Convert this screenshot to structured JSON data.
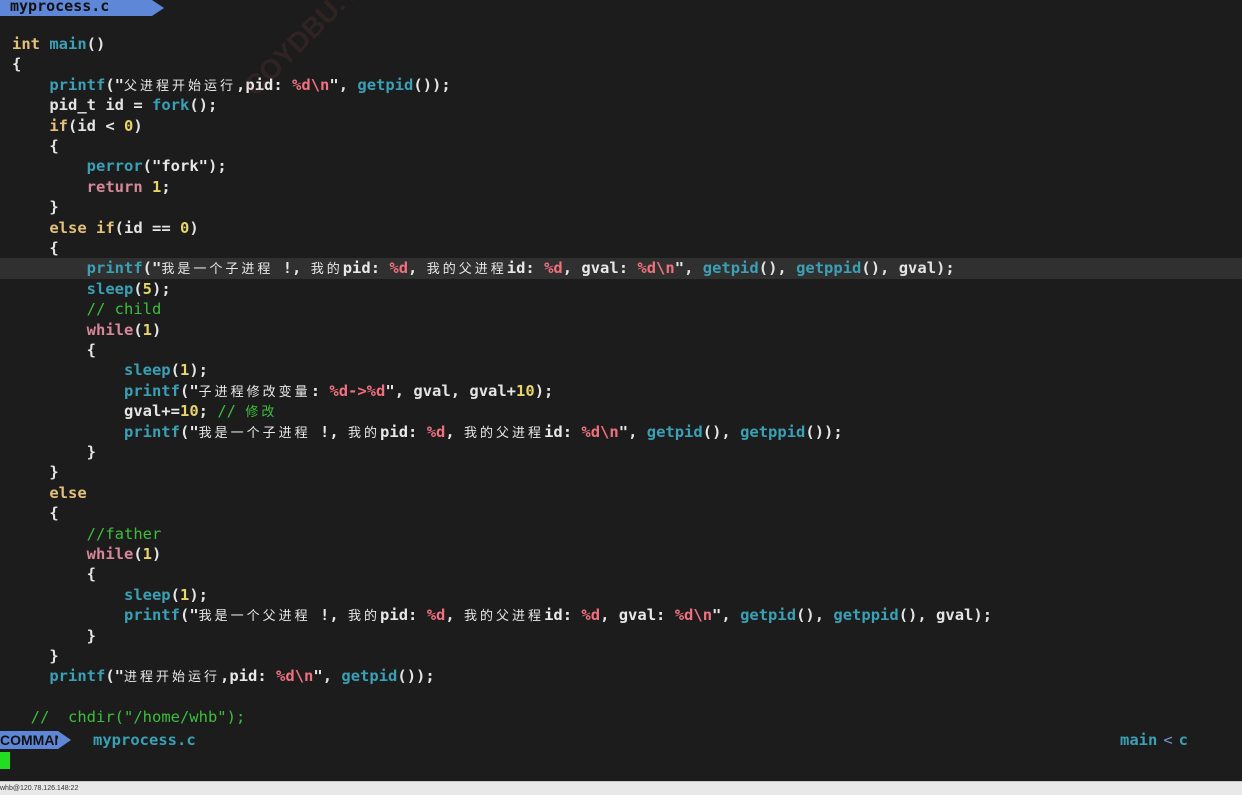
{
  "tabline": {
    "active_tab": "myprocess.c"
  },
  "watermark": "COYDBU.YOU",
  "code_lines": [
    {
      "tokens": [
        [
          "kw",
          "int"
        ],
        [
          "pun",
          " "
        ],
        [
          "fn",
          "main"
        ],
        [
          "pun",
          "()"
        ]
      ]
    },
    {
      "tokens": [
        [
          "pun",
          "{"
        ]
      ]
    },
    {
      "tokens": [
        [
          "pun",
          "    "
        ],
        [
          "fn",
          "printf"
        ],
        [
          "pun",
          "("
        ],
        [
          "str",
          "\""
        ],
        [
          "cjk",
          "父进程开始运行"
        ],
        [
          "str",
          ",pid: "
        ],
        [
          "fmt",
          "%d\\n"
        ],
        [
          "str",
          "\""
        ],
        [
          "pun",
          ", "
        ],
        [
          "fn",
          "getpid"
        ],
        [
          "pun",
          "());"
        ]
      ]
    },
    {
      "tokens": [
        [
          "pun",
          "    "
        ],
        [
          "pun",
          "pid_t id = "
        ],
        [
          "fn",
          "fork"
        ],
        [
          "pun",
          "();"
        ]
      ]
    },
    {
      "tokens": [
        [
          "pun",
          "    "
        ],
        [
          "kw",
          "if"
        ],
        [
          "pun",
          "(id < "
        ],
        [
          "num",
          "0"
        ],
        [
          "pun",
          ")"
        ]
      ]
    },
    {
      "tokens": [
        [
          "pun",
          "    {"
        ]
      ]
    },
    {
      "tokens": [
        [
          "pun",
          "        "
        ],
        [
          "fn",
          "perror"
        ],
        [
          "pun",
          "("
        ],
        [
          "str",
          "\"fork\""
        ],
        [
          "pun",
          ");"
        ]
      ]
    },
    {
      "tokens": [
        [
          "pun",
          "        "
        ],
        [
          "ty",
          "return"
        ],
        [
          "pun",
          " "
        ],
        [
          "num",
          "1"
        ],
        [
          "pun",
          ";"
        ]
      ]
    },
    {
      "tokens": [
        [
          "pun",
          "    }"
        ]
      ]
    },
    {
      "tokens": [
        [
          "pun",
          "    "
        ],
        [
          "kw",
          "else if"
        ],
        [
          "pun",
          "(id == "
        ],
        [
          "num",
          "0"
        ],
        [
          "pun",
          ")"
        ]
      ]
    },
    {
      "tokens": [
        [
          "pun",
          "    {"
        ]
      ]
    },
    {
      "cursorline": true,
      "tokens": [
        [
          "pun",
          "        "
        ],
        [
          "fn",
          "printf"
        ],
        [
          "pun",
          "("
        ],
        [
          "str",
          "\""
        ],
        [
          "cjk",
          "我是一个子进程"
        ],
        [
          "str",
          " !, "
        ],
        [
          "cjk",
          "我的"
        ],
        [
          "str",
          "pid: "
        ],
        [
          "fmt",
          "%d"
        ],
        [
          "str",
          ", "
        ],
        [
          "cjk",
          "我的父进程"
        ],
        [
          "str",
          "id: "
        ],
        [
          "fmt",
          "%d"
        ],
        [
          "str",
          ", gval: "
        ],
        [
          "fmt",
          "%d\\n"
        ],
        [
          "str",
          "\""
        ],
        [
          "pun",
          ", "
        ],
        [
          "fn",
          "getpid"
        ],
        [
          "pun",
          "(), "
        ],
        [
          "fn",
          "getppid"
        ],
        [
          "pun",
          "(), gval);"
        ]
      ]
    },
    {
      "tokens": [
        [
          "pun",
          "        "
        ],
        [
          "fn",
          "sleep"
        ],
        [
          "pun",
          "("
        ],
        [
          "num",
          "5"
        ],
        [
          "pun",
          ");"
        ]
      ]
    },
    {
      "tokens": [
        [
          "pun",
          "        "
        ],
        [
          "cm",
          "// child"
        ]
      ]
    },
    {
      "tokens": [
        [
          "pun",
          "        "
        ],
        [
          "ty",
          "while"
        ],
        [
          "pun",
          "("
        ],
        [
          "num",
          "1"
        ],
        [
          "pun",
          ")"
        ]
      ]
    },
    {
      "tokens": [
        [
          "pun",
          "        {"
        ]
      ]
    },
    {
      "tokens": [
        [
          "pun",
          "            "
        ],
        [
          "fn",
          "sleep"
        ],
        [
          "pun",
          "("
        ],
        [
          "num",
          "1"
        ],
        [
          "pun",
          ");"
        ]
      ]
    },
    {
      "tokens": [
        [
          "pun",
          "            "
        ],
        [
          "fn",
          "printf"
        ],
        [
          "pun",
          "("
        ],
        [
          "str",
          "\""
        ],
        [
          "cjk",
          "子进程修改变量"
        ],
        [
          "str",
          ": "
        ],
        [
          "fmt",
          "%d->%d"
        ],
        [
          "str",
          "\""
        ],
        [
          "pun",
          ", gval, gval+"
        ],
        [
          "num",
          "10"
        ],
        [
          "pun",
          ");"
        ]
      ]
    },
    {
      "tokens": [
        [
          "pun",
          "            gval+="
        ],
        [
          "num",
          "10"
        ],
        [
          "pun",
          "; "
        ],
        [
          "cm",
          "// "
        ],
        [
          "cjk_cm",
          "修改"
        ]
      ]
    },
    {
      "tokens": [
        [
          "pun",
          "            "
        ],
        [
          "fn",
          "printf"
        ],
        [
          "pun",
          "("
        ],
        [
          "str",
          "\""
        ],
        [
          "cjk",
          "我是一个子进程"
        ],
        [
          "str",
          " !, "
        ],
        [
          "cjk",
          "我的"
        ],
        [
          "str",
          "pid: "
        ],
        [
          "fmt",
          "%d"
        ],
        [
          "str",
          ", "
        ],
        [
          "cjk",
          "我的父进程"
        ],
        [
          "str",
          "id: "
        ],
        [
          "fmt",
          "%d\\n"
        ],
        [
          "str",
          "\""
        ],
        [
          "pun",
          ", "
        ],
        [
          "fn",
          "getpid"
        ],
        [
          "pun",
          "(), "
        ],
        [
          "fn",
          "getppid"
        ],
        [
          "pun",
          "());"
        ]
      ]
    },
    {
      "tokens": [
        [
          "pun",
          "        }"
        ]
      ]
    },
    {
      "tokens": [
        [
          "pun",
          "    }"
        ]
      ]
    },
    {
      "tokens": [
        [
          "pun",
          "    "
        ],
        [
          "kw",
          "else"
        ]
      ]
    },
    {
      "tokens": [
        [
          "pun",
          "    {"
        ]
      ]
    },
    {
      "tokens": [
        [
          "pun",
          "        "
        ],
        [
          "cm",
          "//father"
        ]
      ]
    },
    {
      "tokens": [
        [
          "pun",
          "        "
        ],
        [
          "ty",
          "while"
        ],
        [
          "pun",
          "("
        ],
        [
          "num",
          "1"
        ],
        [
          "pun",
          ")"
        ]
      ]
    },
    {
      "tokens": [
        [
          "pun",
          "        {"
        ]
      ]
    },
    {
      "tokens": [
        [
          "pun",
          "            "
        ],
        [
          "fn",
          "sleep"
        ],
        [
          "pun",
          "("
        ],
        [
          "num",
          "1"
        ],
        [
          "pun",
          ");"
        ]
      ]
    },
    {
      "tokens": [
        [
          "pun",
          "            "
        ],
        [
          "fn",
          "printf"
        ],
        [
          "pun",
          "("
        ],
        [
          "str",
          "\""
        ],
        [
          "cjk",
          "我是一个父进程"
        ],
        [
          "str",
          " !, "
        ],
        [
          "cjk",
          "我的"
        ],
        [
          "str",
          "pid: "
        ],
        [
          "fmt",
          "%d"
        ],
        [
          "str",
          ", "
        ],
        [
          "cjk",
          "我的父进程"
        ],
        [
          "str",
          "id: "
        ],
        [
          "fmt",
          "%d"
        ],
        [
          "str",
          ", gval: "
        ],
        [
          "fmt",
          "%d\\n"
        ],
        [
          "str",
          "\""
        ],
        [
          "pun",
          ", "
        ],
        [
          "fn",
          "getpid"
        ],
        [
          "pun",
          "(), "
        ],
        [
          "fn",
          "getppid"
        ],
        [
          "pun",
          "(), gval);"
        ]
      ]
    },
    {
      "tokens": [
        [
          "pun",
          "        }"
        ]
      ]
    },
    {
      "tokens": [
        [
          "pun",
          "    }"
        ]
      ]
    },
    {
      "tokens": [
        [
          "pun",
          "    "
        ],
        [
          "fn",
          "printf"
        ],
        [
          "pun",
          "("
        ],
        [
          "str",
          "\""
        ],
        [
          "cjk",
          "进程开始运行"
        ],
        [
          "str",
          ",pid: "
        ],
        [
          "fmt",
          "%d\\n"
        ],
        [
          "str",
          "\""
        ],
        [
          "pun",
          ", "
        ],
        [
          "fn",
          "getpid"
        ],
        [
          "pun",
          "());"
        ]
      ]
    },
    {
      "tokens": []
    },
    {
      "tokens": [
        [
          "pun",
          "  "
        ],
        [
          "cm",
          "//  chdir(\"/home/whb\");"
        ]
      ]
    }
  ],
  "statusline": {
    "mode": "COMMAND",
    "filename": "myprocess.c",
    "function": "main",
    "separator": "<",
    "filetype": "c"
  },
  "taskbar": {
    "host": "whb@120.78.126.148:22"
  },
  "colors": {
    "background": "#1c1c1c",
    "accent": "#5f87d7",
    "keyword": "#e5c07b",
    "function": "#3aa0b5",
    "format": "#f0707e",
    "number": "#e8d46a",
    "comment": "#3cbf3c"
  }
}
